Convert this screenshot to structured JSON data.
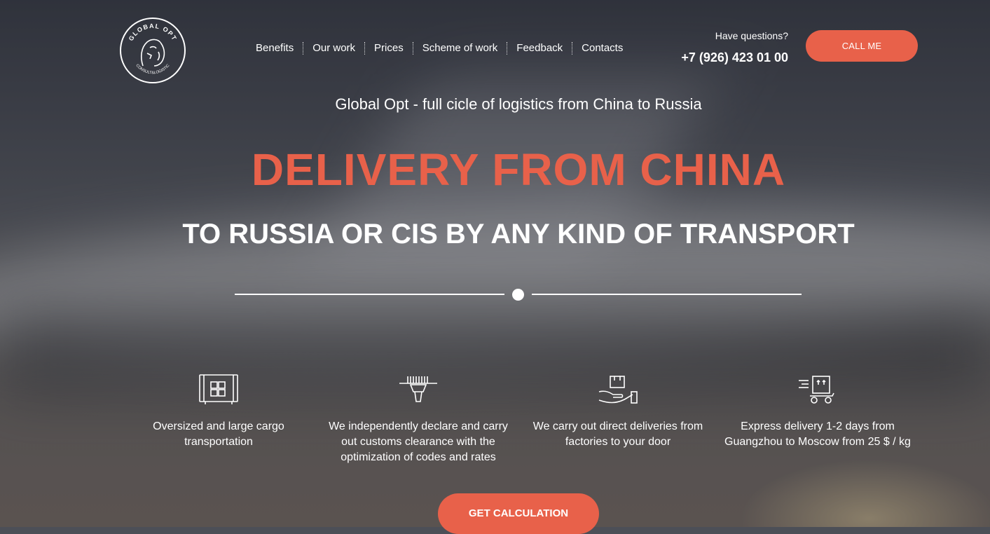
{
  "brand": {
    "logo_top_text": "GLOBAL OPT",
    "logo_bottom_text": "CONSULT&LOGISTIC"
  },
  "nav": {
    "items": [
      "Benefits",
      "Our work",
      "Prices",
      "Scheme of work",
      "Feedback",
      "Contacts"
    ]
  },
  "contact": {
    "questions": "Have questions?",
    "phone": "+7 (926) 423 01 00",
    "call_button": "CALL ME"
  },
  "hero": {
    "tagline": "Global Opt - full cicle of logistics from China to Russia",
    "headline": "DELIVERY FROM CHINA",
    "subheadline": "TO RUSSIA OR CIS BY ANY KIND OF TRANSPORT"
  },
  "features": [
    {
      "icon": "cargo-container-icon",
      "text": "Oversized and large cargo transportation"
    },
    {
      "icon": "barcode-scanner-icon",
      "text": "We independently declare and carry out customs clearance with the optimization of codes and rates"
    },
    {
      "icon": "hand-box-icon",
      "text": "We carry out direct deliveries from factories to your door"
    },
    {
      "icon": "express-cart-icon",
      "text": "Express delivery 1-2 days from Guangzhou to Moscow from 25 $ / kg"
    }
  ],
  "cta": {
    "label": "GET CALCULATION"
  },
  "colors": {
    "accent": "#e8614a",
    "text": "#ffffff"
  }
}
